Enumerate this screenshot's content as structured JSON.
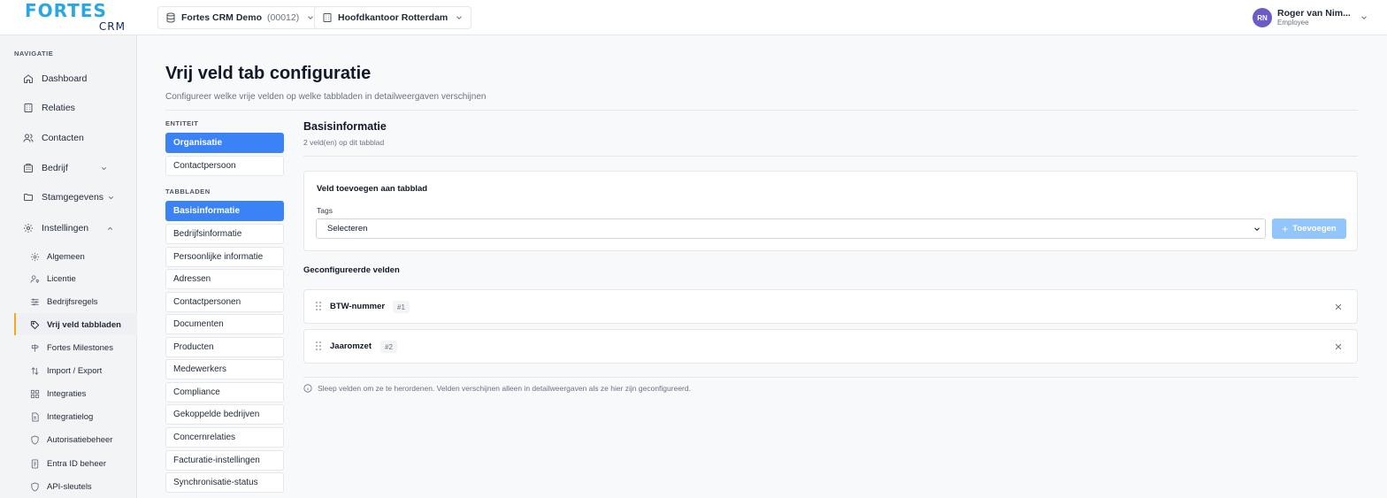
{
  "brand": {
    "name": "FORTES",
    "sub": "CRM",
    "color": "#2aa6e0"
  },
  "header": {
    "company": {
      "name": "Fortes CRM Demo",
      "code": "(00012)"
    },
    "office": "Hoofdkantoor Rotterdam",
    "user": {
      "initials": "RN",
      "name": "Roger van Nim...",
      "role": "Employee"
    }
  },
  "sidebar": {
    "heading": "NAVIGATIE",
    "items": [
      {
        "label": "Dashboard",
        "icon": "home-icon"
      },
      {
        "label": "Relaties",
        "icon": "building-icon"
      },
      {
        "label": "Contacten",
        "icon": "users-icon"
      },
      {
        "label": "Bedrijf",
        "icon": "building-icon",
        "expandable": true
      },
      {
        "label": "Stamgegevens",
        "icon": "folder-icon",
        "expandable": true
      },
      {
        "label": "Instellingen",
        "icon": "gear-icon",
        "expanded": true
      }
    ],
    "sub_items": [
      {
        "label": "Algemeen",
        "icon": "gear-icon"
      },
      {
        "label": "Licentie",
        "icon": "user-key-icon"
      },
      {
        "label": "Bedrijfsregels",
        "icon": "sliders-icon"
      },
      {
        "label": "Vrij veld tabbladen",
        "icon": "tag-icon",
        "active": true
      },
      {
        "label": "Fortes Milestones",
        "icon": "signpost-icon"
      },
      {
        "label": "Import / Export",
        "icon": "arrows-updown-icon"
      },
      {
        "label": "Integraties",
        "icon": "blocks-icon"
      },
      {
        "label": "Integratielog",
        "icon": "file-icon"
      },
      {
        "label": "Autorisatiebeheer",
        "icon": "shield-icon"
      },
      {
        "label": "Entra ID beheer",
        "icon": "id-card-icon"
      },
      {
        "label": "API-sleutels",
        "icon": "shield-icon"
      }
    ]
  },
  "page": {
    "title": "Vrij veld tab configuratie",
    "subtitle": "Configureer welke vrije velden op welke tabbladen in detailweergaven verschijnen"
  },
  "entity": {
    "heading": "ENTITEIT",
    "items": [
      {
        "label": "Organisatie",
        "active": true
      },
      {
        "label": "Contactpersoon"
      }
    ]
  },
  "tabs": {
    "heading": "TABBLADEN",
    "items": [
      {
        "label": "Basisinformatie",
        "active": true
      },
      {
        "label": "Bedrijfsinformatie"
      },
      {
        "label": "Persoonlijke informatie"
      },
      {
        "label": "Adressen"
      },
      {
        "label": "Contactpersonen"
      },
      {
        "label": "Documenten"
      },
      {
        "label": "Producten"
      },
      {
        "label": "Medewerkers"
      },
      {
        "label": "Compliance"
      },
      {
        "label": "Gekoppelde bedrijven"
      },
      {
        "label": "Concernrelaties"
      },
      {
        "label": "Facturatie-instellingen"
      },
      {
        "label": "Synchronisatie-status"
      }
    ]
  },
  "section": {
    "title": "Basisinformatie",
    "subtitle": "2 veld(en) op dit tabblad"
  },
  "add_field": {
    "title": "Veld toevoegen aan tabblad",
    "label": "Tags",
    "select_value": "Selecteren",
    "button": "Toevoegen"
  },
  "configured": {
    "title": "Geconfigureerde velden",
    "fields": [
      {
        "name": "BTW-nummer",
        "order": "#1"
      },
      {
        "name": "Jaaromzet",
        "order": "#2"
      }
    ]
  },
  "hint": "Sleep velden om ze te herordenen. Velden verschijnen alleen in detailweergaven als ze hier zijn geconfigureerd.",
  "colors": {
    "primary": "#3b82f6",
    "primary_disabled": "#93c5fd",
    "active_accent": "#f5a623",
    "avatar": "#6d5ac6"
  }
}
